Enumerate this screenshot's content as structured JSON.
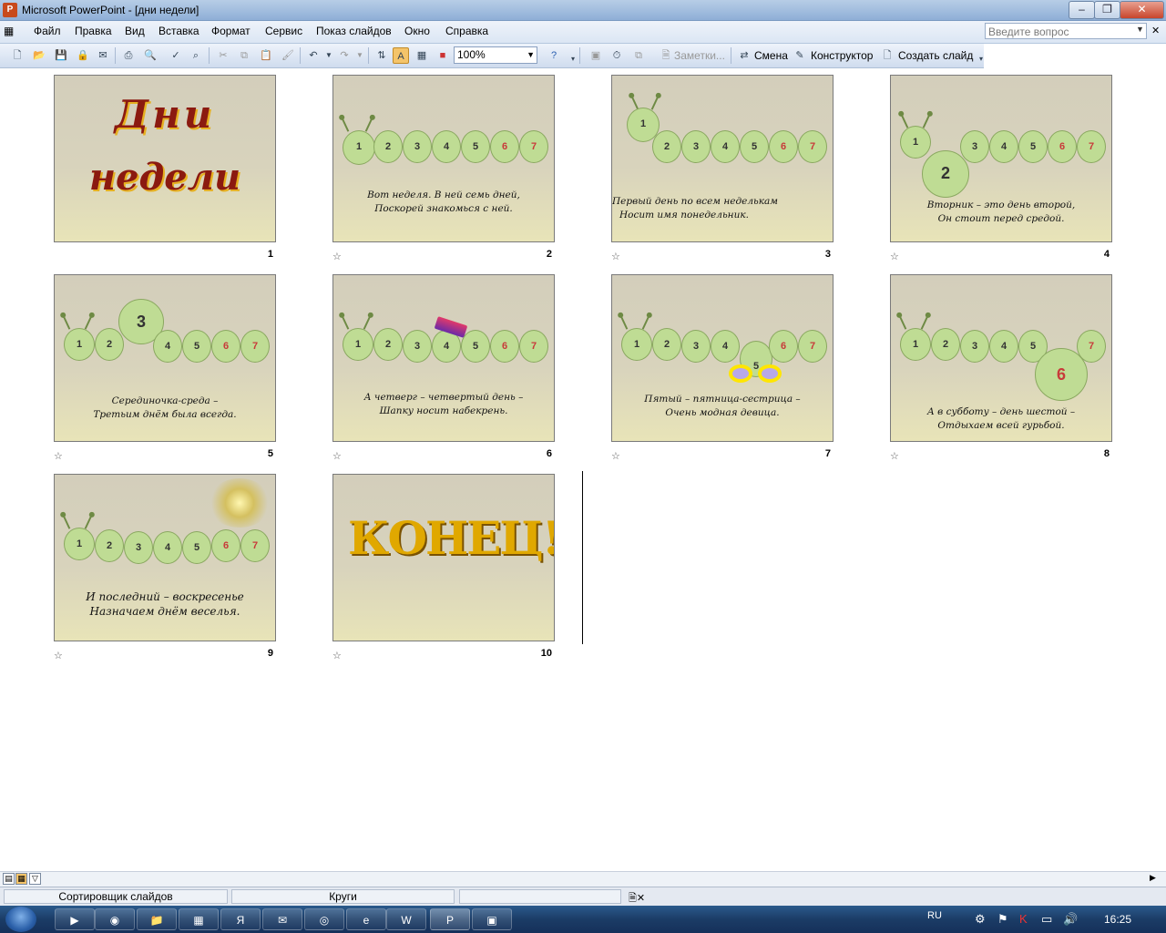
{
  "window": {
    "title": "Microsoft PowerPoint - [дни недели]"
  },
  "menu": {
    "items": [
      "Файл",
      "Правка",
      "Вид",
      "Вставка",
      "Формат",
      "Сервис",
      "Показ слайдов",
      "Окно",
      "Справка"
    ],
    "help_placeholder": "Введите вопрос"
  },
  "toolbar": {
    "zoom": "100%",
    "notes": "Заметки...",
    "transition": "Смена",
    "designer": "Конструктор",
    "new_slide": "Создать слайд"
  },
  "slides": [
    {
      "number": "1",
      "title_line1": "Дни",
      "title_line2": "недели"
    },
    {
      "number": "2",
      "caption_line1": "Вот неделя. В ней семь дней,",
      "caption_line2": "Поскорей знакомься с ней."
    },
    {
      "number": "3",
      "caption_line1": "Первый день по всем неделькам",
      "caption_line2": "Носит имя понедельник."
    },
    {
      "number": "4",
      "caption_line1": "Вторник – это день второй,",
      "caption_line2": "Он стоит перед средой."
    },
    {
      "number": "5",
      "caption_line1": "Серединочка-среда –",
      "caption_line2": "Третьим днём была всегда."
    },
    {
      "number": "6",
      "caption_line1": "А четверг – четвертый день –",
      "caption_line2": "Шапку носит набекрень."
    },
    {
      "number": "7",
      "caption_line1": "Пятый – пятница-сестрица –",
      "caption_line2": "Очень модная девица."
    },
    {
      "number": "8",
      "caption_line1": "А в субботу – день шестой –",
      "caption_line2": "Отдыхаем всей гурьбой."
    },
    {
      "number": "9",
      "caption_line1": "И последний – воскресенье",
      "caption_line2": "Назначаем днём веселья."
    },
    {
      "number": "10",
      "end_text": "КОНЕЦ!"
    }
  ],
  "status": {
    "view": "Сортировщик слайдов",
    "design": "Круги"
  },
  "taskbar": {
    "lang": "RU",
    "clock": "16:25"
  },
  "colors": {
    "slide_bg": "#d6d1bd",
    "caterpillar": "#bfdc94",
    "title_red": "#8b1a10"
  }
}
